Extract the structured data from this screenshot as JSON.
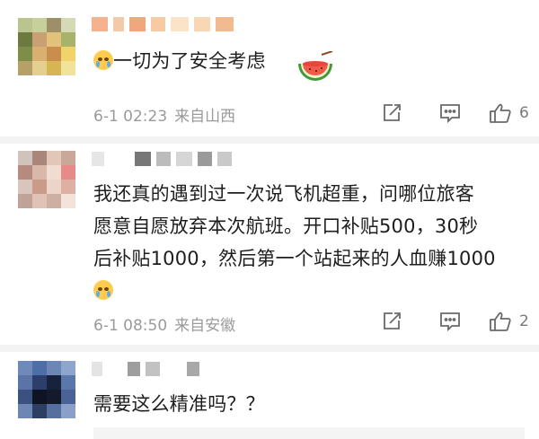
{
  "colors": {
    "meta_gray": "#9a9a9a",
    "icon_gray": "#6a6a6a",
    "separator": "#f3f3f3"
  },
  "comments": [
    {
      "text_lines": [
        "一切为了安全考虑"
      ],
      "meta": {
        "date": "6-1 02:23",
        "location": "来自山西"
      },
      "actions": {
        "share_icon": "share-icon",
        "comment_icon": "comment-icon",
        "like_icon": "thumbs-up-icon",
        "like_count": "6"
      }
    },
    {
      "text_lines": [
        "我还真的遇到过一次说飞机超重，问哪位旅客",
        "愿意自愿放弃本次航班。开口补贴500，30秒",
        "后补贴1000，然后第一个站起来的人血赚1000"
      ],
      "meta": {
        "date": "6-1 08:50",
        "location": "来自安徽"
      },
      "actions": {
        "share_icon": "share-icon",
        "comment_icon": "comment-icon",
        "like_icon": "thumbs-up-icon",
        "like_count": "2"
      }
    },
    {
      "text_lines": [
        "需要这么精准吗？？"
      ]
    }
  ]
}
